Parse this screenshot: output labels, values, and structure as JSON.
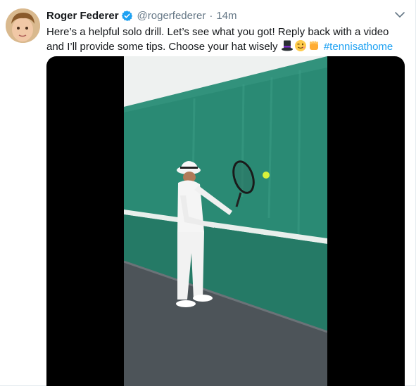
{
  "tweet": {
    "author_name": "Roger Federer",
    "handle": "@rogerfederer",
    "separator": "·",
    "time": "14m",
    "text_line1": "Here’s a helpful solo drill. Let’s see what you got! Reply back with a video",
    "text_line2_prefix": "and I’ll provide some tips. Choose your hat wisely ",
    "hashtag": "#tennisathome",
    "emojis": [
      "top-hat-icon",
      "winking-face-icon",
      "fist-bump-icon"
    ]
  },
  "colors": {
    "link": "#1da1f2",
    "verified": "#1da1f2",
    "muted": "#657786",
    "wall": "#2a8a74"
  }
}
